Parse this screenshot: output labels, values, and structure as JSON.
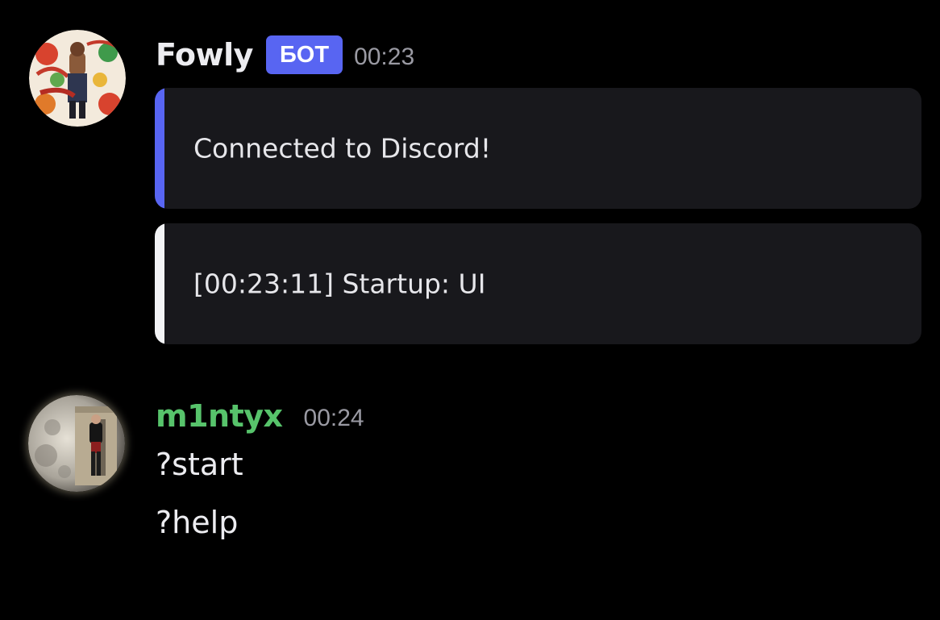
{
  "colors": {
    "background": "#000000",
    "bot_tag_bg": "#5865f2",
    "embed_bg": "#18181c",
    "embed1_accent": "#5865f2",
    "embed2_accent": "#f2f3f5",
    "username_bot": "#ececf0",
    "username_user": "#57c36b",
    "timestamp": "#9a9aa3"
  },
  "messages": [
    {
      "avatar_icon": "album-cover-avatar",
      "username": "Fowly",
      "bot_tag": "БОТ",
      "timestamp": "00:23",
      "embeds": [
        {
          "text": "Connected to Discord!"
        },
        {
          "text": "[00:23:11] Startup: UI"
        }
      ]
    },
    {
      "avatar_icon": "moon-photo-avatar",
      "username": "m1ntyx",
      "timestamp": "00:24",
      "lines": [
        "?start",
        "?help"
      ]
    }
  ]
}
